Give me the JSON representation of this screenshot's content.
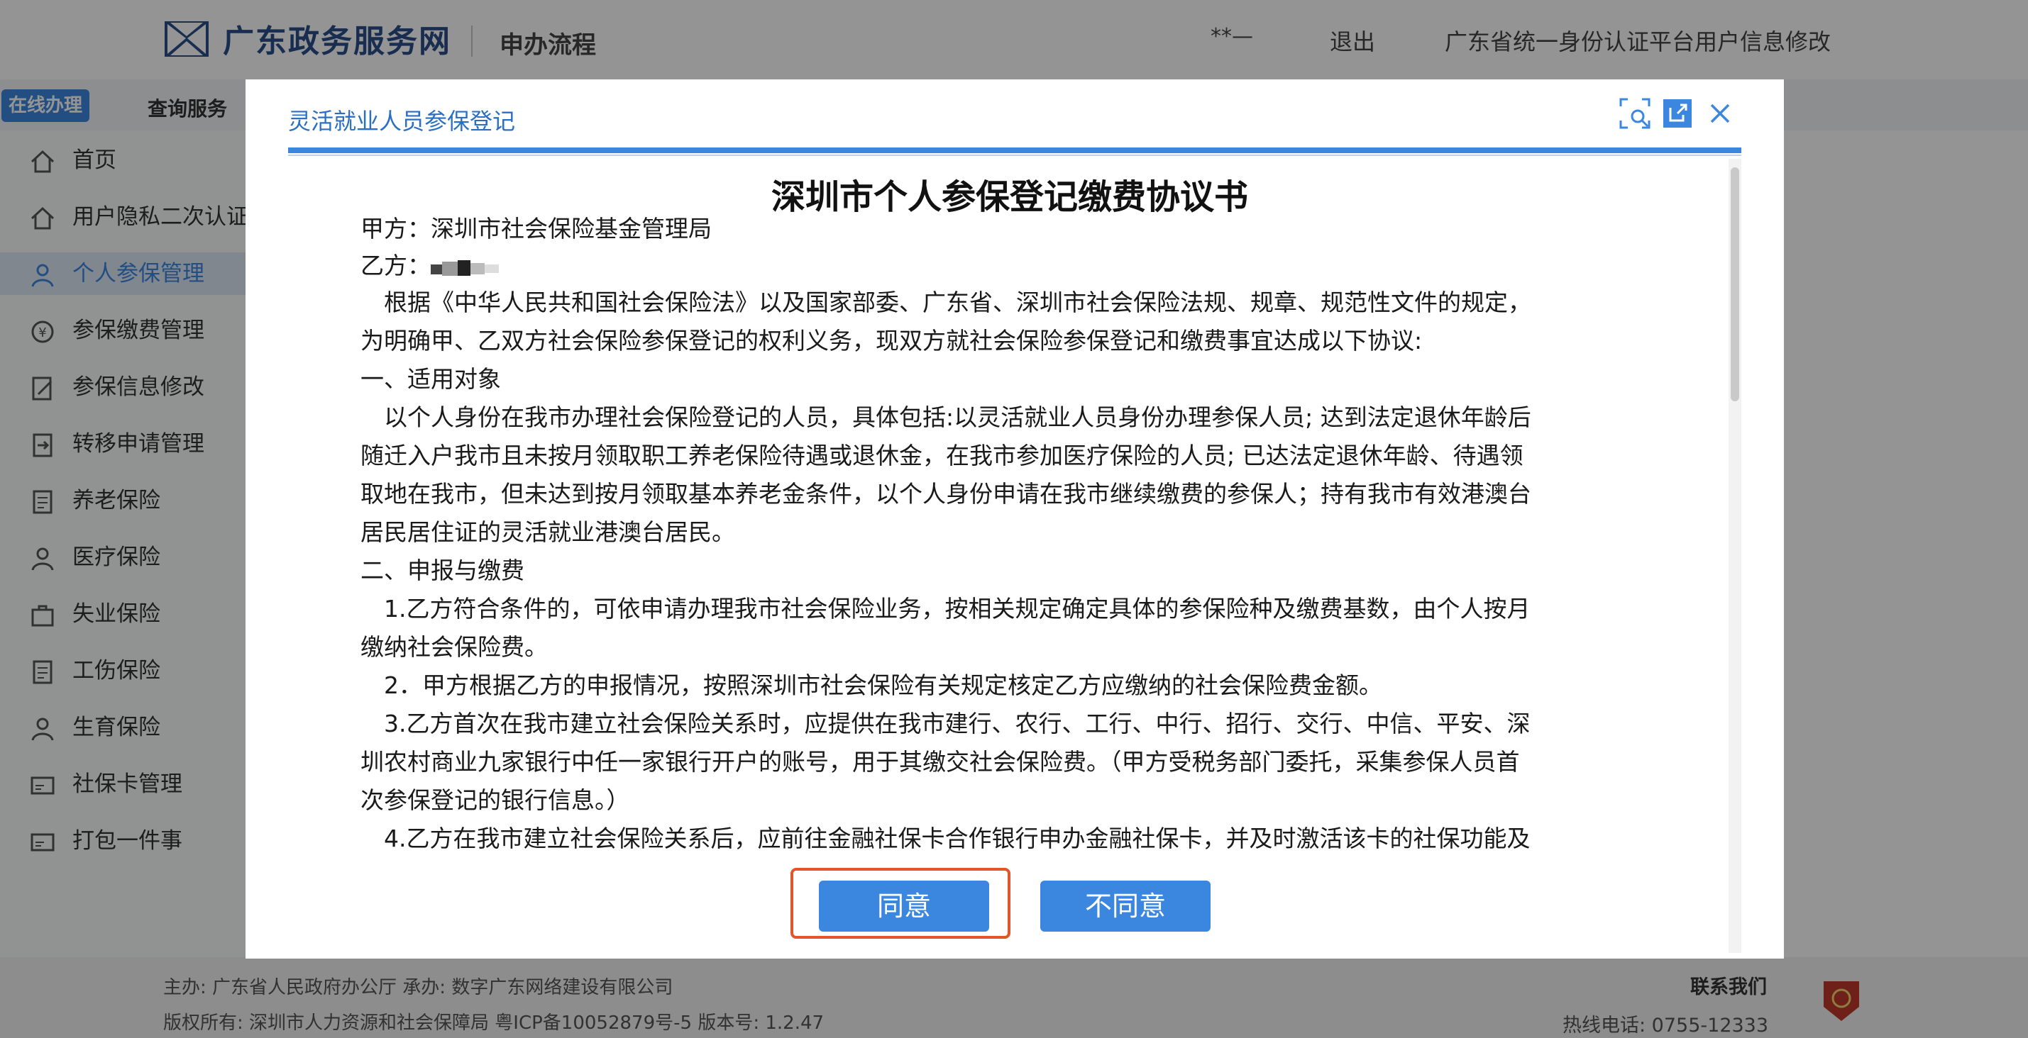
{
  "header": {
    "brand": "广东政务服务网",
    "subtitle": "申办流程",
    "user": "**—",
    "logout": "退出",
    "modify_link": "广东省统一身份认证平台用户信息修改"
  },
  "nav": {
    "online": "在线办理",
    "query": "查询服务"
  },
  "sidebar": {
    "items": [
      {
        "label": "首页",
        "icon": "home-icon"
      },
      {
        "label": "用户隐私二次认证",
        "icon": "home-icon"
      },
      {
        "label": "个人参保管理",
        "icon": "person-icon"
      },
      {
        "label": "参保缴费管理",
        "icon": "payment-icon"
      },
      {
        "label": "参保信息修改",
        "icon": "edit-icon"
      },
      {
        "label": "转移申请管理",
        "icon": "transfer-icon"
      },
      {
        "label": "养老保险",
        "icon": "document-icon"
      },
      {
        "label": "医疗保险",
        "icon": "person-icon"
      },
      {
        "label": "失业保险",
        "icon": "briefcase-icon"
      },
      {
        "label": "工伤保险",
        "icon": "document-icon"
      },
      {
        "label": "生育保险",
        "icon": "person-icon"
      },
      {
        "label": "社保卡管理",
        "icon": "card-icon"
      },
      {
        "label": "打包一件事",
        "icon": "card-icon"
      }
    ],
    "active_index": 2
  },
  "modal": {
    "title": "灵活就业人员参保登记",
    "tools": [
      "fullscreen-icon",
      "open-external-icon",
      "close-icon"
    ],
    "doc_title": "深圳市个人参保登记缴费协议书",
    "party_a": "甲方：深圳市社会保险基金管理局",
    "party_b": "乙方：",
    "lines": [
      "　根据《中华人民共和国社会保险法》以及国家部委、广东省、深圳市社会保险法规、规章、规范性文件的规定，",
      "为明确甲、乙双方社会保险参保登记的权利义务，现双方就社会保险参保登记和缴费事宜达成以下协议:",
      "一、适用对象",
      "　以个人身份在我市办理社会保险登记的人员，具体包括:以灵活就业人员身份办理参保人员; 达到法定退休年龄后",
      "随迁入户我市且未按月领取职工养老保险待遇或退休金，在我市参加医疗保险的人员; 已达法定退休年龄、待遇领",
      "取地在我市，但未达到按月领取基本养老金条件，以个人身份申请在我市继续缴费的参保人；持有我市有效港澳台",
      "居民居住证的灵活就业港澳台居民。",
      "二、申报与缴费",
      "　1.乙方符合条件的，可依申请办理我市社会保险业务，按相关规定确定具体的参保险种及缴费基数，由个人按月",
      "缴纳社会保险费。",
      "　2．甲方根据乙方的申报情况，按照深圳市社会保险有关规定核定乙方应缴纳的社会保险费金额。",
      "　3.乙方首次在我市建立社会保险关系时，应提供在我市建行、农行、工行、中行、招行、交行、中信、平安、深",
      "圳农村商业九家银行中任一家银行开户的账号，用于其缴交社会保险费。（甲方受税务部门委托，采集参保人员首",
      "次参保登记的银行信息。）",
      "　4.乙方在我市建立社会保险关系后，应前往金融社保卡合作银行申办金融社保卡，并及时激活该卡的社保功能及"
    ],
    "agree": "同意",
    "disagree": "不同意"
  },
  "footer": {
    "line1": "主办:  广东省人民政府办公厅      承办:  数字广东网络建设有限公司",
    "line2": "版权所有:   深圳市人力资源和社会保障局   粤ICP备10052879号-5    版本号:  1.2.47",
    "contact": "联系我们",
    "hotline": "热线电话:  0755-12333"
  },
  "colors": {
    "accent": "#3b87e0",
    "highlight": "#e0552a",
    "title_blue": "#2b6fc2"
  }
}
